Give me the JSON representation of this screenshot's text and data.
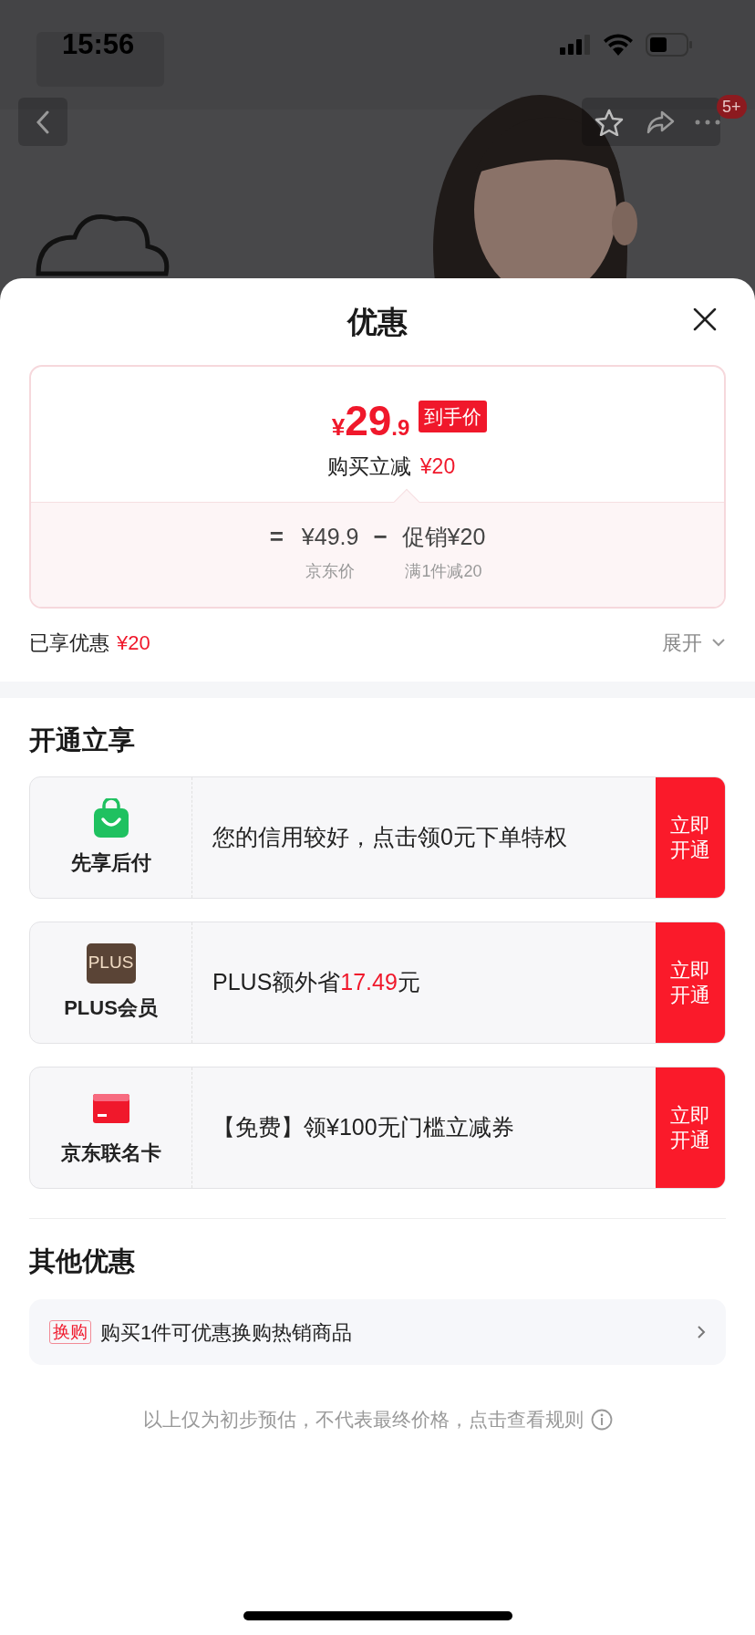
{
  "status_bar": {
    "time": "15:56"
  },
  "nav": {
    "badge": "5+"
  },
  "sheet": {
    "title": "优惠"
  },
  "price_card": {
    "currency": "¥",
    "price_integer": "29",
    "price_decimal": ".9",
    "price_tag": "到手价",
    "subtitle_label": "购买立减",
    "subtitle_amount": "¥20",
    "equals": "=",
    "breakdown": [
      {
        "amount": "¥49.9",
        "label": "京东价"
      },
      {
        "operator": "−",
        "amount": "促销¥20",
        "label": "满1件减20"
      }
    ]
  },
  "enjoyed": {
    "label": "已享优惠",
    "amount": "¥20",
    "expand": "展开"
  },
  "open_section": {
    "title": "开通立享",
    "offers": [
      {
        "kind": "pay-later",
        "name": "先享后付",
        "segments": [
          {
            "text": "您的信用较好，点击领0元下单特权",
            "highlight": false
          }
        ],
        "button": "立即开通"
      },
      {
        "kind": "plus",
        "icon_text": "PLUS",
        "name": "PLUS会员",
        "segments": [
          {
            "text": "PLUS额外省",
            "highlight": false
          },
          {
            "text": "17.49",
            "highlight": true
          },
          {
            "text": "元",
            "highlight": false
          }
        ],
        "button": "立即开通"
      },
      {
        "kind": "card",
        "name": "京东联名卡",
        "segments": [
          {
            "text": "【免费】领¥100无门槛立减券",
            "highlight": false
          }
        ],
        "button": "立即开通"
      }
    ]
  },
  "other_section": {
    "title": "其他优惠",
    "items": [
      {
        "tag": "换购",
        "text": "购买1件可优惠换购热销商品"
      }
    ]
  },
  "footer_note": "以上仅为初步预估，不代表最终价格，点击查看规则"
}
